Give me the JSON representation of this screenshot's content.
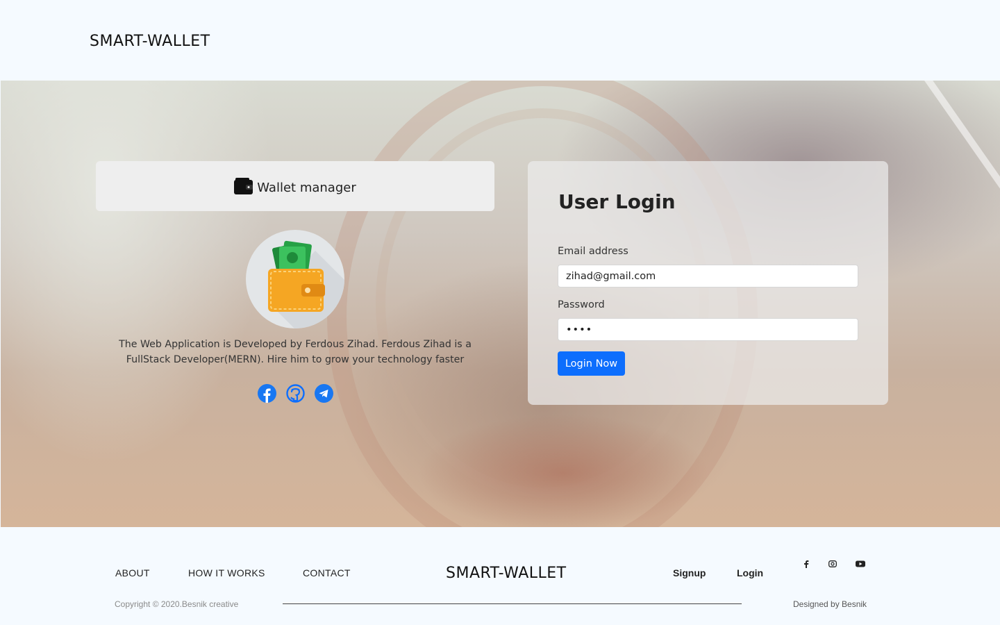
{
  "header": {
    "brand": "SMART-WALLET"
  },
  "hero": {
    "wallet_manager_title": "Wallet manager",
    "about": "The Web Application is Developed by Ferdous Zihad. Ferdous Zihad is a FullStack Developer(MERN). Hire him to grow your technology faster",
    "social_icons": [
      "facebook-icon",
      "github-icon",
      "telegram-icon"
    ],
    "accent_color": "#0d6efd"
  },
  "login": {
    "title": "User Login",
    "email_label": "Email address",
    "email_value": "zihad@gmail.com",
    "password_label": "Password",
    "password_value": "••••",
    "submit_label": "Login Now"
  },
  "footer": {
    "nav": [
      "ABOUT",
      "HOW IT WORKS",
      "CONTACT"
    ],
    "brand": "SMART-WALLET",
    "links": [
      "Signup",
      "Login"
    ],
    "social_icons": [
      "facebook-icon",
      "instagram-icon",
      "youtube-icon"
    ],
    "copyright": "Copyright © 2020.Besnik creative",
    "designed_by": "Designed by Besnik"
  }
}
